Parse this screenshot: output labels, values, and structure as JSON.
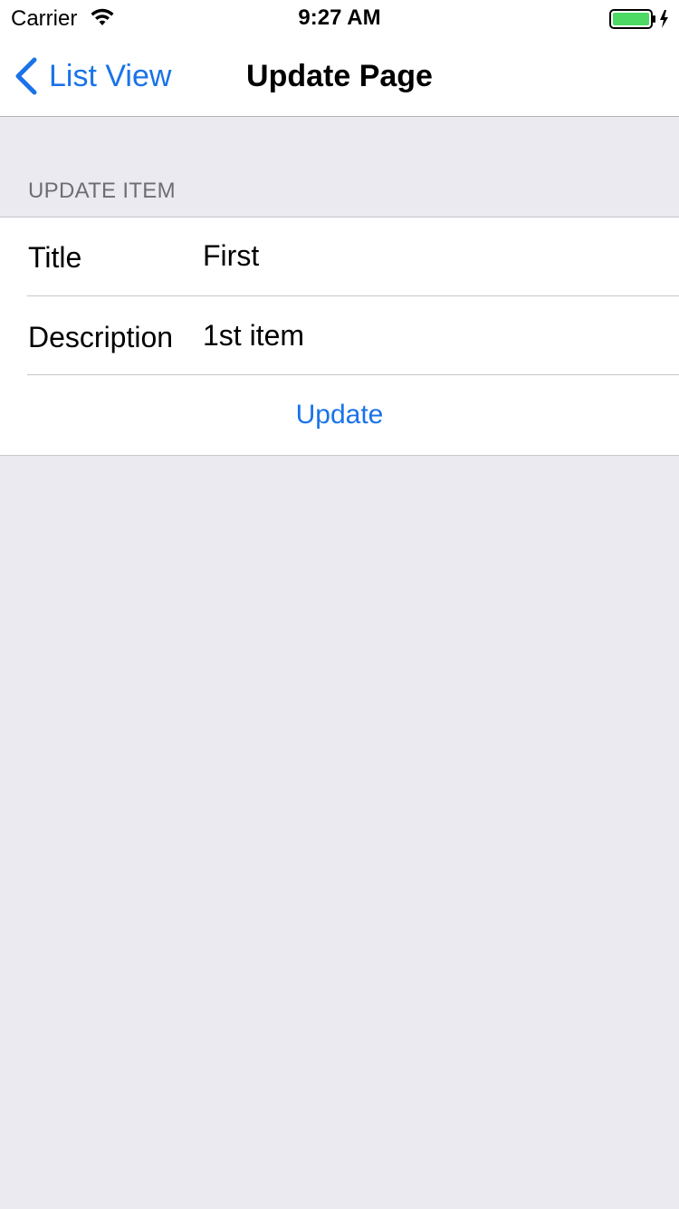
{
  "status_bar": {
    "carrier": "Carrier",
    "time": "9:27 AM",
    "battery_color": "#4CD964"
  },
  "nav": {
    "back_label": "List View",
    "title": "Update Page",
    "accent_color": "#1A73E8"
  },
  "section": {
    "header": "UPDATE ITEM"
  },
  "form": {
    "title_label": "Title",
    "title_value": "First",
    "description_label": "Description",
    "description_value": "1st item",
    "update_label": "Update"
  }
}
